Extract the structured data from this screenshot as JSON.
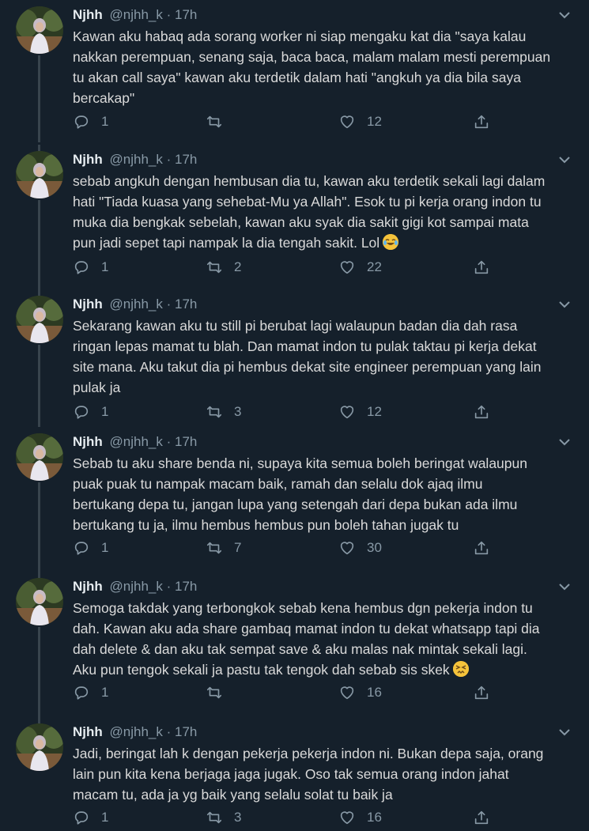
{
  "tweets": [
    {
      "name": "Njhh",
      "handle": "@njhh_k",
      "separator": "·",
      "time": "17h",
      "text": "Kawan aku habaq ada sorang worker ni siap mengaku kat dia \"saya kalau\nnakkan perempuan, senang saja, baca baca, malam malam mesti perempuan\ntu akan call saya\" kawan aku terdetik dalam hati \"angkuh ya dia bila saya\nbercakap\"",
      "emoji": "",
      "replies": "1",
      "retweets": "",
      "likes": "12"
    },
    {
      "name": "Njhh",
      "handle": "@njhh_k",
      "separator": "·",
      "time": "17h",
      "text": "sebab angkuh dengan hembusan dia tu, kawan aku terdetik sekali lagi dalam\nhati \"Tiada kuasa yang sehebat-Mu ya Allah\". Esok tu pi kerja orang indon tu\nmuka dia bengkak sebelah, kawan aku syak dia sakit gigi kot sampai mata\npun jadi sepet tapi nampak la dia tengah sakit. Lol",
      "emoji": "face-with-tears-of-joy",
      "replies": "1",
      "retweets": "2",
      "likes": "22"
    },
    {
      "name": "Njhh",
      "handle": "@njhh_k",
      "separator": "·",
      "time": "17h",
      "text": "Sekarang kawan aku tu still pi berubat lagi walaupun badan dia dah rasa\nringan lepas mamat tu blah. Dan mamat indon tu pulak taktau pi kerja dekat\nsite mana. Aku takut dia pi hembus dekat site engineer perempuan yang lain\npulak ja",
      "emoji": "",
      "replies": "1",
      "retweets": "3",
      "likes": "12"
    },
    {
      "name": "Njhh",
      "handle": "@njhh_k",
      "separator": "·",
      "time": "17h",
      "text": "Sebab tu aku share benda ni, supaya kita semua boleh beringat walaupun\npuak puak tu nampak macam baik, ramah dan selalu dok ajaq ilmu\nbertukang depa tu, jangan lupa yang setengah dari depa bukan ada ilmu\nbertukang tu ja, ilmu hembus hembus pun boleh tahan jugak tu",
      "emoji": "",
      "replies": "1",
      "retweets": "7",
      "likes": "30"
    },
    {
      "name": "Njhh",
      "handle": "@njhh_k",
      "separator": "·",
      "time": "17h",
      "text": "Semoga takdak yang terbongkok sebab kena hembus dgn pekerja indon tu\ndah. Kawan aku ada share gambaq mamat indon tu dekat whatsapp tapi dia\ndah delete & dan aku tak sempat save & aku malas nak mintak sekali lagi.\nAku pun tengok sekali ja pastu tak tengok dah sebab sis skek",
      "emoji": "persevering-face",
      "replies": "1",
      "retweets": "",
      "likes": "16"
    },
    {
      "name": "Njhh",
      "handle": "@njhh_k",
      "separator": "·",
      "time": "17h",
      "text": "Jadi, beringat lah k dengan pekerja pekerja indon ni. Bukan depa saja, orang\nlain pun kita kena berjaga jaga jugak. Oso tak semua orang indon jahat\nmacam tu, ada ja yg baik yang selalu solat tu baik ja",
      "emoji": "",
      "replies": "1",
      "retweets": "3",
      "likes": "16"
    }
  ],
  "icons": {
    "reply": "reply-icon",
    "retweet": "retweet-icon",
    "like": "heart-icon",
    "share": "share-icon",
    "menu": "chevron-down-icon"
  },
  "colors": {
    "background": "#15202b",
    "text": "#d9d9d9",
    "muted": "#8899a6",
    "thread_line": "#38444d"
  }
}
